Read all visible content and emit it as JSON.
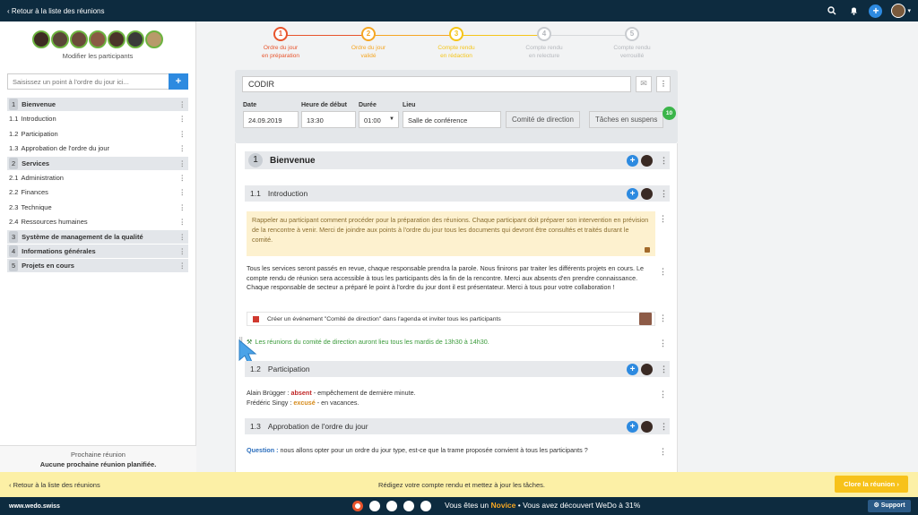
{
  "topbar": {
    "back_label": "Retour à la liste des réunions"
  },
  "sidebar": {
    "modify_participants": "Modifier les participants",
    "search_placeholder": "Saisissez un point à l'ordre du jour ici...",
    "add_label": "+",
    "items": [
      {
        "num": "1",
        "label": "Bienvenue",
        "section": true
      },
      {
        "num": "1.1",
        "label": "Introduction",
        "section": false
      },
      {
        "num": "1.2",
        "label": "Participation",
        "section": false
      },
      {
        "num": "1.3",
        "label": "Approbation de l'ordre du jour",
        "section": false
      },
      {
        "num": "2",
        "label": "Services",
        "section": true
      },
      {
        "num": "2.1",
        "label": "Administration",
        "section": false
      },
      {
        "num": "2.2",
        "label": "Finances",
        "section": false
      },
      {
        "num": "2.3",
        "label": "Technique",
        "section": false
      },
      {
        "num": "2.4",
        "label": "Ressources humaines",
        "section": false
      },
      {
        "num": "3",
        "label": "Système de management de la qualité",
        "section": true
      },
      {
        "num": "4",
        "label": "Informations générales",
        "section": true
      },
      {
        "num": "5",
        "label": "Projets en cours",
        "section": true
      }
    ],
    "next_meeting_label": "Prochaine réunion",
    "next_meeting_value": "Aucune prochaine réunion planifiée."
  },
  "steps": [
    {
      "num": "1",
      "line1": "Ordre du jour",
      "line2": "en préparation",
      "color": "#e8542c"
    },
    {
      "num": "2",
      "line1": "Ordre du jour",
      "line2": "validé",
      "color": "#f5a623"
    },
    {
      "num": "3",
      "line1": "Compte rendu",
      "line2": "en rédaction",
      "color": "#f5c518"
    },
    {
      "num": "4",
      "line1": "Compte rendu",
      "line2": "en relecture",
      "color": "#c9ccd0"
    },
    {
      "num": "5",
      "line1": "Compte rendu",
      "line2": "verrouillé",
      "color": "#c9ccd0"
    }
  ],
  "meeting": {
    "title": "CODIR",
    "date_label": "Date",
    "date": "24.09.2019",
    "start_label": "Heure de début",
    "start": "13:30",
    "duration_label": "Durée",
    "duration": "01:00",
    "place_label": "Lieu",
    "place": "Salle de conférence",
    "committee": "Comité de direction",
    "tasks": "Tâches en suspens",
    "tasks_count": "10"
  },
  "content": {
    "s1_num": "1",
    "s1_title": "Bienvenue",
    "s11_num": "1.1",
    "s11_title": "Introduction",
    "note": "Rappeler au participant comment procéder pour la préparation des réunions. Chaque participant doit préparer son intervention en prévision de la rencontre à venir. Merci de joindre aux points à l'ordre du jour tous les documents qui devront être consultés et traités durant le comité.",
    "paragraph": "Tous les services seront passés en revue, chaque responsable prendra la parole. Nous finirons par traiter les différents projets en cours. Le compte rendu de réunion sera accessible à tous les participants dès la fin de la rencontre. Merci aux absents d'en prendre connaissance. Chaque responsable de secteur a préparé le point à l'ordre du jour dont il est présentateur. Merci à tous pour votre collaboration !",
    "task": "Créer un événement \"Comité de direction\" dans l'agenda et inviter tous les participants",
    "decision": "Les réunions du comité de direction auront lieu tous les mardis de 13h30 à 14h30.",
    "s12_num": "1.2",
    "s12_title": "Participation",
    "att1_name": "Alain Brügger :",
    "att1_status": "absent",
    "att1_reason": "- empêchement de dernière minute.",
    "att2_name": "Frédéric Singy :",
    "att2_status": "excusé",
    "att2_reason": "- en vacances.",
    "s13_num": "1.3",
    "s13_title": "Approbation de l'ordre du jour",
    "q_label": "Question :",
    "q_text": "nous allons opter pour un ordre du jour type, est-ce que la trame proposée convient à tous les participants ?"
  },
  "bottombar": {
    "back_label": "Retour à la liste des réunions",
    "message": "Rédigez votre compte rendu et mettez à jour les tâches.",
    "close_label": "Clore la réunion"
  },
  "footer": {
    "site": "www.wedo.swiss",
    "msg_pre": "Vous êtes un ",
    "msg_level": "Novice",
    "msg_post": " • Vous avez découvert WeDo à 31%",
    "support": "Support"
  }
}
